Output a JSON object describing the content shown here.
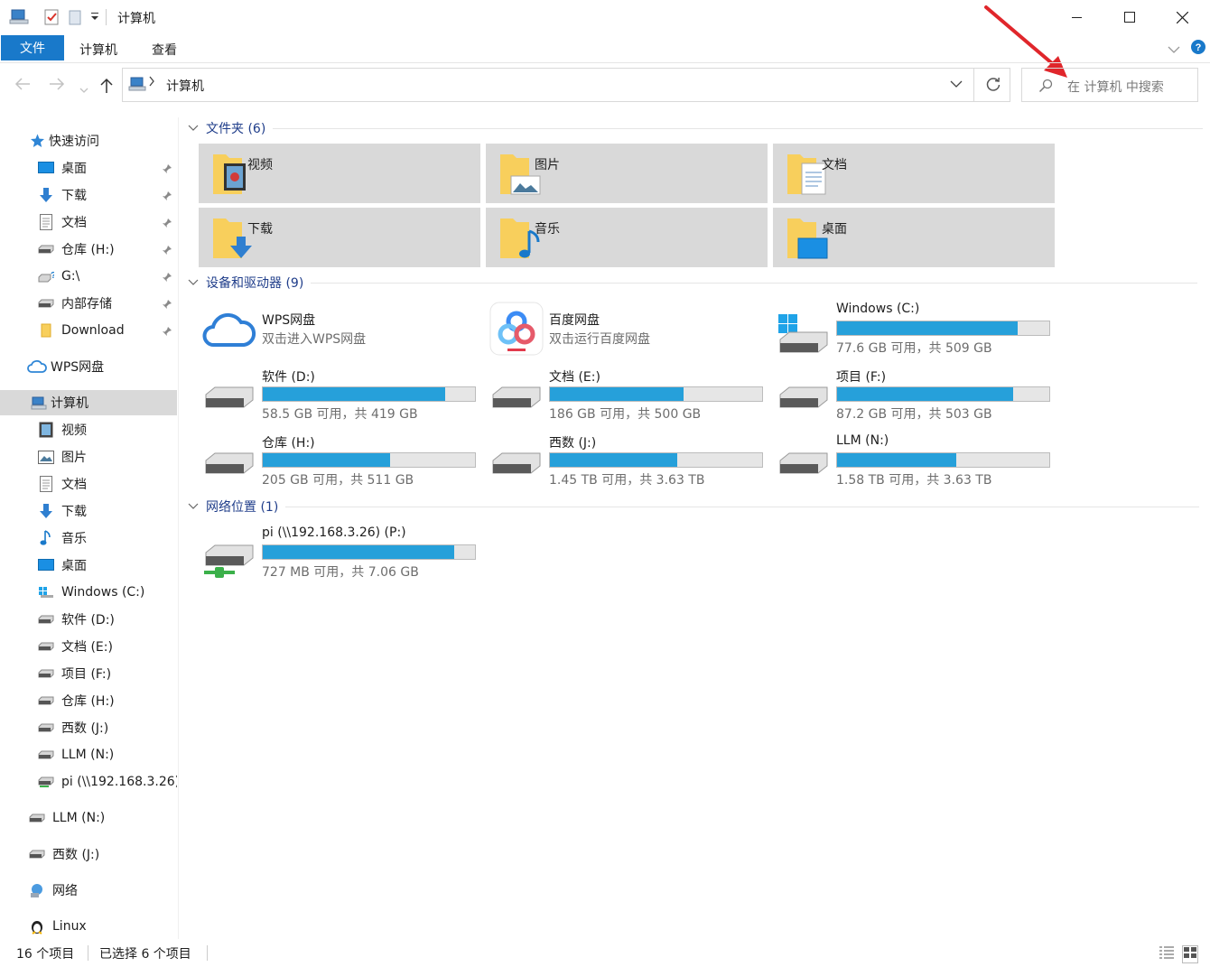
{
  "window": {
    "title": "计算机"
  },
  "ribbon": {
    "tabs": [
      "文件",
      "计算机",
      "查看"
    ]
  },
  "address": {
    "path": "计算机",
    "search_placeholder": "在 计算机 中搜索"
  },
  "sidebar": {
    "quick_access": "快速访问",
    "quick_items": [
      "桌面",
      "下载",
      "文档",
      "仓库 (H:)",
      "G:\\",
      "内部存储",
      "Download"
    ],
    "wps": "WPS网盘",
    "computer": "计算机",
    "computer_items": [
      "视频",
      "图片",
      "文档",
      "下载",
      "音乐",
      "桌面",
      "Windows (C:)",
      "软件 (D:)",
      "文档 (E:)",
      "项目 (F:)",
      "仓库 (H:)",
      "西数 (J:)",
      "LLM (N:)",
      "pi (\\\\192.168.3.26)"
    ],
    "extra_items": [
      "LLM (N:)",
      "西数 (J:)",
      "网络",
      "Linux"
    ]
  },
  "sections": {
    "folders": "文件夹 (6)",
    "devices": "设备和驱动器 (9)",
    "network": "网络位置 (1)"
  },
  "folders": [
    {
      "label": "视频",
      "icon": "video-folder-icon"
    },
    {
      "label": "图片",
      "icon": "pictures-folder-icon"
    },
    {
      "label": "文档",
      "icon": "documents-folder-icon"
    },
    {
      "label": "下载",
      "icon": "downloads-folder-icon"
    },
    {
      "label": "音乐",
      "icon": "music-folder-icon"
    },
    {
      "label": "桌面",
      "icon": "desktop-folder-icon"
    }
  ],
  "apps": [
    {
      "name": "WPS网盘",
      "desc": "双击进入WPS网盘",
      "icon": "wps-cloud-icon"
    },
    {
      "name": "百度网盘",
      "desc": "双击运行百度网盘",
      "icon": "baidu-netdisk-icon"
    }
  ],
  "drives": [
    {
      "name": "Windows (C:)",
      "info": "77.6 GB 可用，共 509 GB",
      "used_fraction": 0.85,
      "icon": "windows-drive-icon"
    },
    {
      "name": "软件 (D:)",
      "info": "58.5 GB 可用，共 419 GB",
      "used_fraction": 0.86,
      "icon": "hdd-icon"
    },
    {
      "name": "文档 (E:)",
      "info": "186 GB 可用，共 500 GB",
      "used_fraction": 0.63,
      "icon": "hdd-icon"
    },
    {
      "name": "项目 (F:)",
      "info": "87.2 GB 可用，共 503 GB",
      "used_fraction": 0.83,
      "icon": "hdd-icon"
    },
    {
      "name": "仓库 (H:)",
      "info": "205 GB 可用，共 511 GB",
      "used_fraction": 0.6,
      "icon": "hdd-icon"
    },
    {
      "name": "西数 (J:)",
      "info": "1.45 TB 可用，共 3.63 TB",
      "used_fraction": 0.6,
      "icon": "hdd-icon"
    },
    {
      "name": "LLM (N:)",
      "info": "1.58 TB 可用，共 3.63 TB",
      "used_fraction": 0.56,
      "icon": "hdd-icon"
    }
  ],
  "network_drive": {
    "name": "pi (\\\\192.168.3.26) (P:)",
    "info": "727 MB 可用，共 7.06 GB",
    "used_fraction": 0.9,
    "icon": "network-drive-icon"
  },
  "status": {
    "count": "16 个项目",
    "selected": "已选择 6 个项目"
  },
  "colors": {
    "accent": "#1979ca",
    "bar": "#26a0da",
    "arrow": "#e0262b"
  }
}
